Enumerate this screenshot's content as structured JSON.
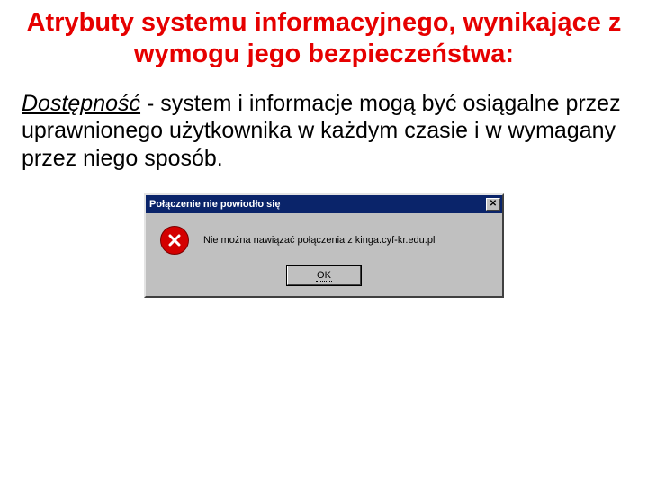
{
  "heading": "Atrybuty systemu informacyjnego, wynikające z wymogu jego bezpieczeństwa:",
  "body": {
    "term": "Dostępność",
    "rest": " - system i informacje mogą być osiągalne przez uprawnionego użytkownika w każdym czasie i w wymagany przez niego sposób."
  },
  "dialog": {
    "title": "Połączenie nie powiodło się",
    "close_glyph": "✕",
    "message": "Nie można nawiązać połączenia z kinga.cyf-kr.edu.pl",
    "ok_label": "OK"
  }
}
